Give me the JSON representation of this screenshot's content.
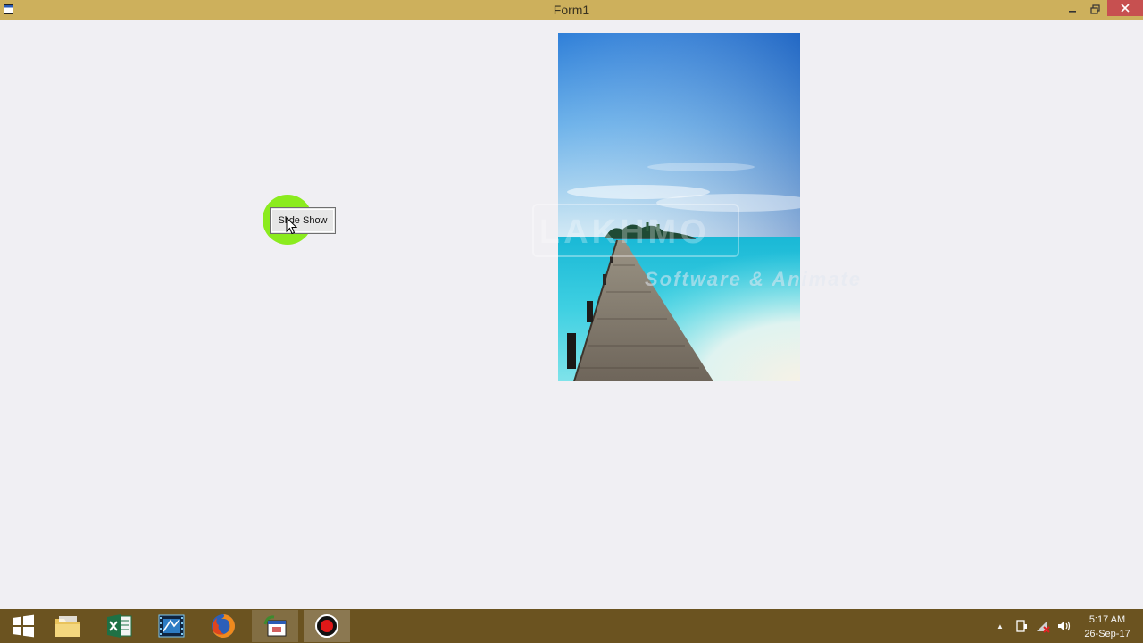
{
  "window": {
    "title": "Form1",
    "minimize_glyph": "—",
    "restore_glyph": "❐",
    "close_glyph": "✕"
  },
  "form": {
    "slide_button_label": "Slide Show",
    "picture": {
      "subject": "wooden pier leading to a small island over turquoise sea",
      "watermark_logo": "LAKHMO",
      "watermark_tagline": "Software & Animate"
    }
  },
  "taskbar": {
    "items": [
      {
        "name": "start",
        "icon": "windows-logo-icon"
      },
      {
        "name": "file-explorer",
        "icon": "folder-icon"
      },
      {
        "name": "excel",
        "icon": "excel-icon"
      },
      {
        "name": "movie-maker",
        "icon": "film-icon"
      },
      {
        "name": "firefox",
        "icon": "firefox-icon"
      },
      {
        "name": "visual-studio",
        "icon": "app-icon",
        "active": true
      },
      {
        "name": "screen-recorder",
        "icon": "record-icon",
        "active": true
      }
    ],
    "tray": {
      "show_hidden_glyph": "▲",
      "icons": [
        "action-center-icon",
        "network-icon",
        "volume-icon"
      ]
    },
    "clock": {
      "time": "5:17 AM",
      "date": "26-Sep-17"
    }
  },
  "colors": {
    "titlebar": "#cdb05c",
    "form_background": "#f0eff3",
    "taskbar": "#6b5320",
    "close_button": "#c75050",
    "click_indicator": "#7cea00"
  }
}
